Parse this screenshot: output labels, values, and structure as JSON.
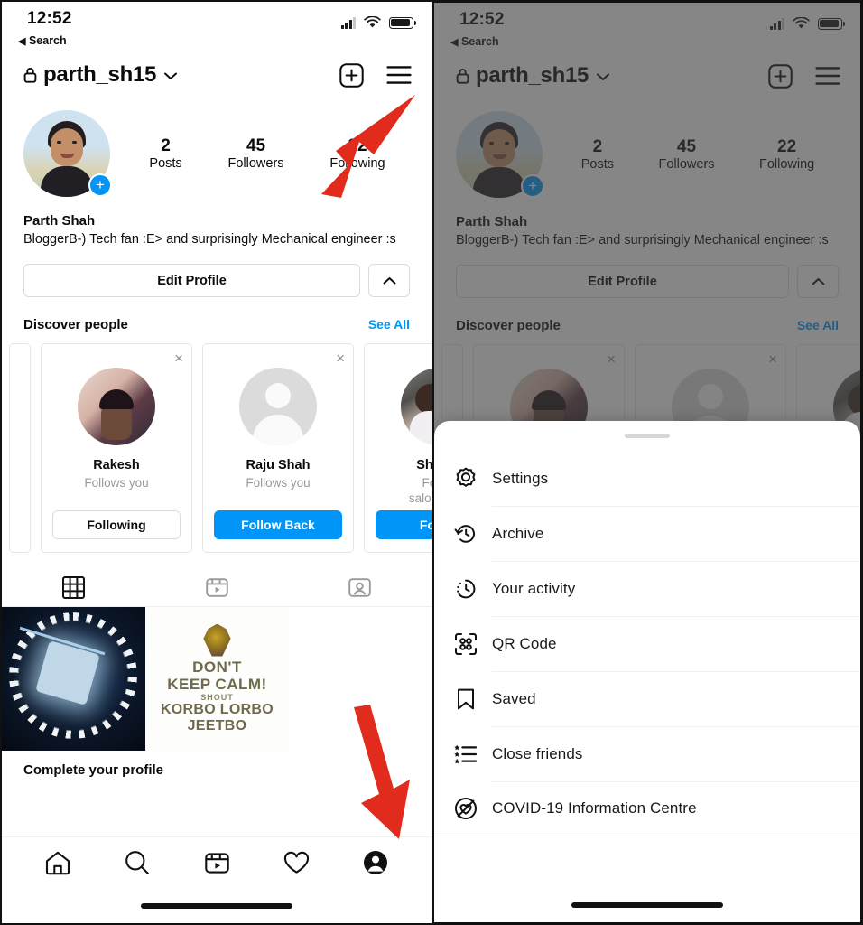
{
  "statusbar": {
    "time": "12:52",
    "back_label": "Search",
    "back_caret": "◀",
    "icons": [
      "cellular-signal-icon",
      "wifi-icon",
      "battery-icon"
    ]
  },
  "header": {
    "lock_icon": "lock-icon",
    "username": "parth_sh15",
    "chevron": "chevron-down-icon",
    "add_label": "+",
    "menu_icon": "hamburger-menu-icon"
  },
  "profile": {
    "avatar_badge": "+",
    "full_name": "Parth Shah",
    "bio": "BloggerB-) Tech fan :E> and surprisingly Mechanical engineer :s",
    "stats": [
      {
        "value": "2",
        "label": "Posts"
      },
      {
        "value": "45",
        "label": "Followers"
      },
      {
        "value": "22",
        "label": "Following"
      }
    ],
    "edit_button": "Edit Profile",
    "caret_button": "chevron-up-icon"
  },
  "discover": {
    "title": "Discover people",
    "see_all": "See All",
    "close_label": "×",
    "cards": [
      {
        "name": "Rakesh",
        "sub": "Follows you",
        "action": "Following",
        "style": "ghost"
      },
      {
        "name": "Raju Shah",
        "sub": "Follows you",
        "action": "Follow Back",
        "style": "blue"
      },
      {
        "name": "Shah M",
        "sub": "Follow\nsaloni.shah",
        "action": "Follow",
        "style": "blue"
      }
    ]
  },
  "grid_tabs": [
    {
      "icon": "grid-icon",
      "selected": true
    },
    {
      "icon": "reels-icon",
      "selected": false
    },
    {
      "icon": "tagged-icon",
      "selected": false
    }
  ],
  "posts": {
    "post2_line1": "DON'T",
    "post2_line2": "KEEP CALM!",
    "post2_line3": "SHOUT",
    "post2_line4": "KORBO LORBO",
    "post2_line5": "JEETBO"
  },
  "complete_profile": "Complete your profile",
  "bottom_nav": [
    {
      "icon": "home-icon",
      "selected": false
    },
    {
      "icon": "search-icon",
      "selected": false
    },
    {
      "icon": "reels-icon",
      "selected": false
    },
    {
      "icon": "heart-icon",
      "selected": false
    },
    {
      "icon": "profile-avatar-icon",
      "selected": true
    }
  ],
  "sheet": {
    "grabber": "drag-handle",
    "items": [
      {
        "label": "Settings",
        "icon": "gear-icon"
      },
      {
        "label": "Archive",
        "icon": "archive-clock-icon"
      },
      {
        "label": "Your activity",
        "icon": "activity-clock-icon"
      },
      {
        "label": "QR Code",
        "icon": "qr-code-icon"
      },
      {
        "label": "Saved",
        "icon": "bookmark-icon"
      },
      {
        "label": "Close friends",
        "icon": "close-friends-list-icon"
      },
      {
        "label": "COVID-19 Information Centre",
        "icon": "covid-info-icon"
      }
    ]
  },
  "annotations": {
    "arrow_color": "#e02b1d",
    "arrow_menu": "arrow-pointing-to-hamburger-menu",
    "arrow_profile_tab": "arrow-pointing-to-profile-tab",
    "arrow_settings": "arrow-pointing-to-settings"
  },
  "colors": {
    "accent_blue": "#0095f6",
    "text": "#0b0b0b",
    "muted": "#9a9a9a",
    "border": "#dbdbdb",
    "dim_overlay": "#3c3c3c"
  }
}
